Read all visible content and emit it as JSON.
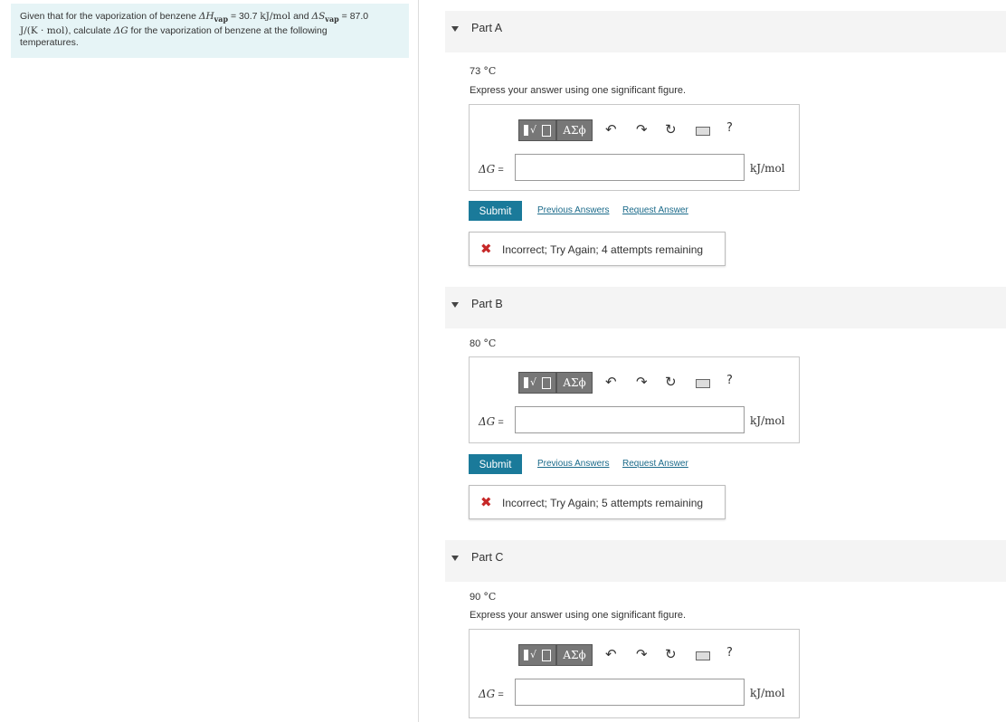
{
  "problem": {
    "intro": "Given that for the vaporization of benzene",
    "dH": "ΔH",
    "dH_sub": "vap",
    "eq1": " = 30.7 ",
    "unit1": "kJ/mol",
    "and": " and ",
    "dS": "ΔS",
    "dS_sub": "vap",
    "eq2": " = 87.0",
    "unit2": "J/(K · mol)",
    "mid": ", calculate ",
    "dG": "ΔG",
    "tail": " for the vaporization of benzene at the following",
    "tail2": "temperatures."
  },
  "toolbar": {
    "greek": "ΑΣϕ",
    "undo_icon": "↶",
    "redo_icon": "↷",
    "reset_icon": "↻",
    "help": "?"
  },
  "parts": [
    {
      "label": "Part A",
      "temp_val": "73",
      "temp_unit": "°C",
      "instruction": "Express your answer using one significant figure.",
      "eq_label": "ΔG",
      "eq_sign": " =",
      "input_value": "",
      "unit": "kJ/mol",
      "submit": "Submit",
      "prev": "Previous Answers",
      "req": "Request Answer",
      "feedback_icon": "✖",
      "feedback": "Incorrect; Try Again; 4 attempts remaining"
    },
    {
      "label": "Part B",
      "temp_val": "80",
      "temp_unit": "°C",
      "eq_label": "ΔG",
      "eq_sign": " =",
      "input_value": "",
      "unit": "kJ/mol",
      "submit": "Submit",
      "prev": "Previous Answers",
      "req": "Request Answer",
      "feedback_icon": "✖",
      "feedback": "Incorrect; Try Again; 5 attempts remaining"
    },
    {
      "label": "Part C",
      "temp_val": "90",
      "temp_unit": "°C",
      "instruction": "Express your answer using one significant figure.",
      "eq_label": "ΔG",
      "eq_sign": " =",
      "input_value": "",
      "unit": "kJ/mol"
    }
  ]
}
